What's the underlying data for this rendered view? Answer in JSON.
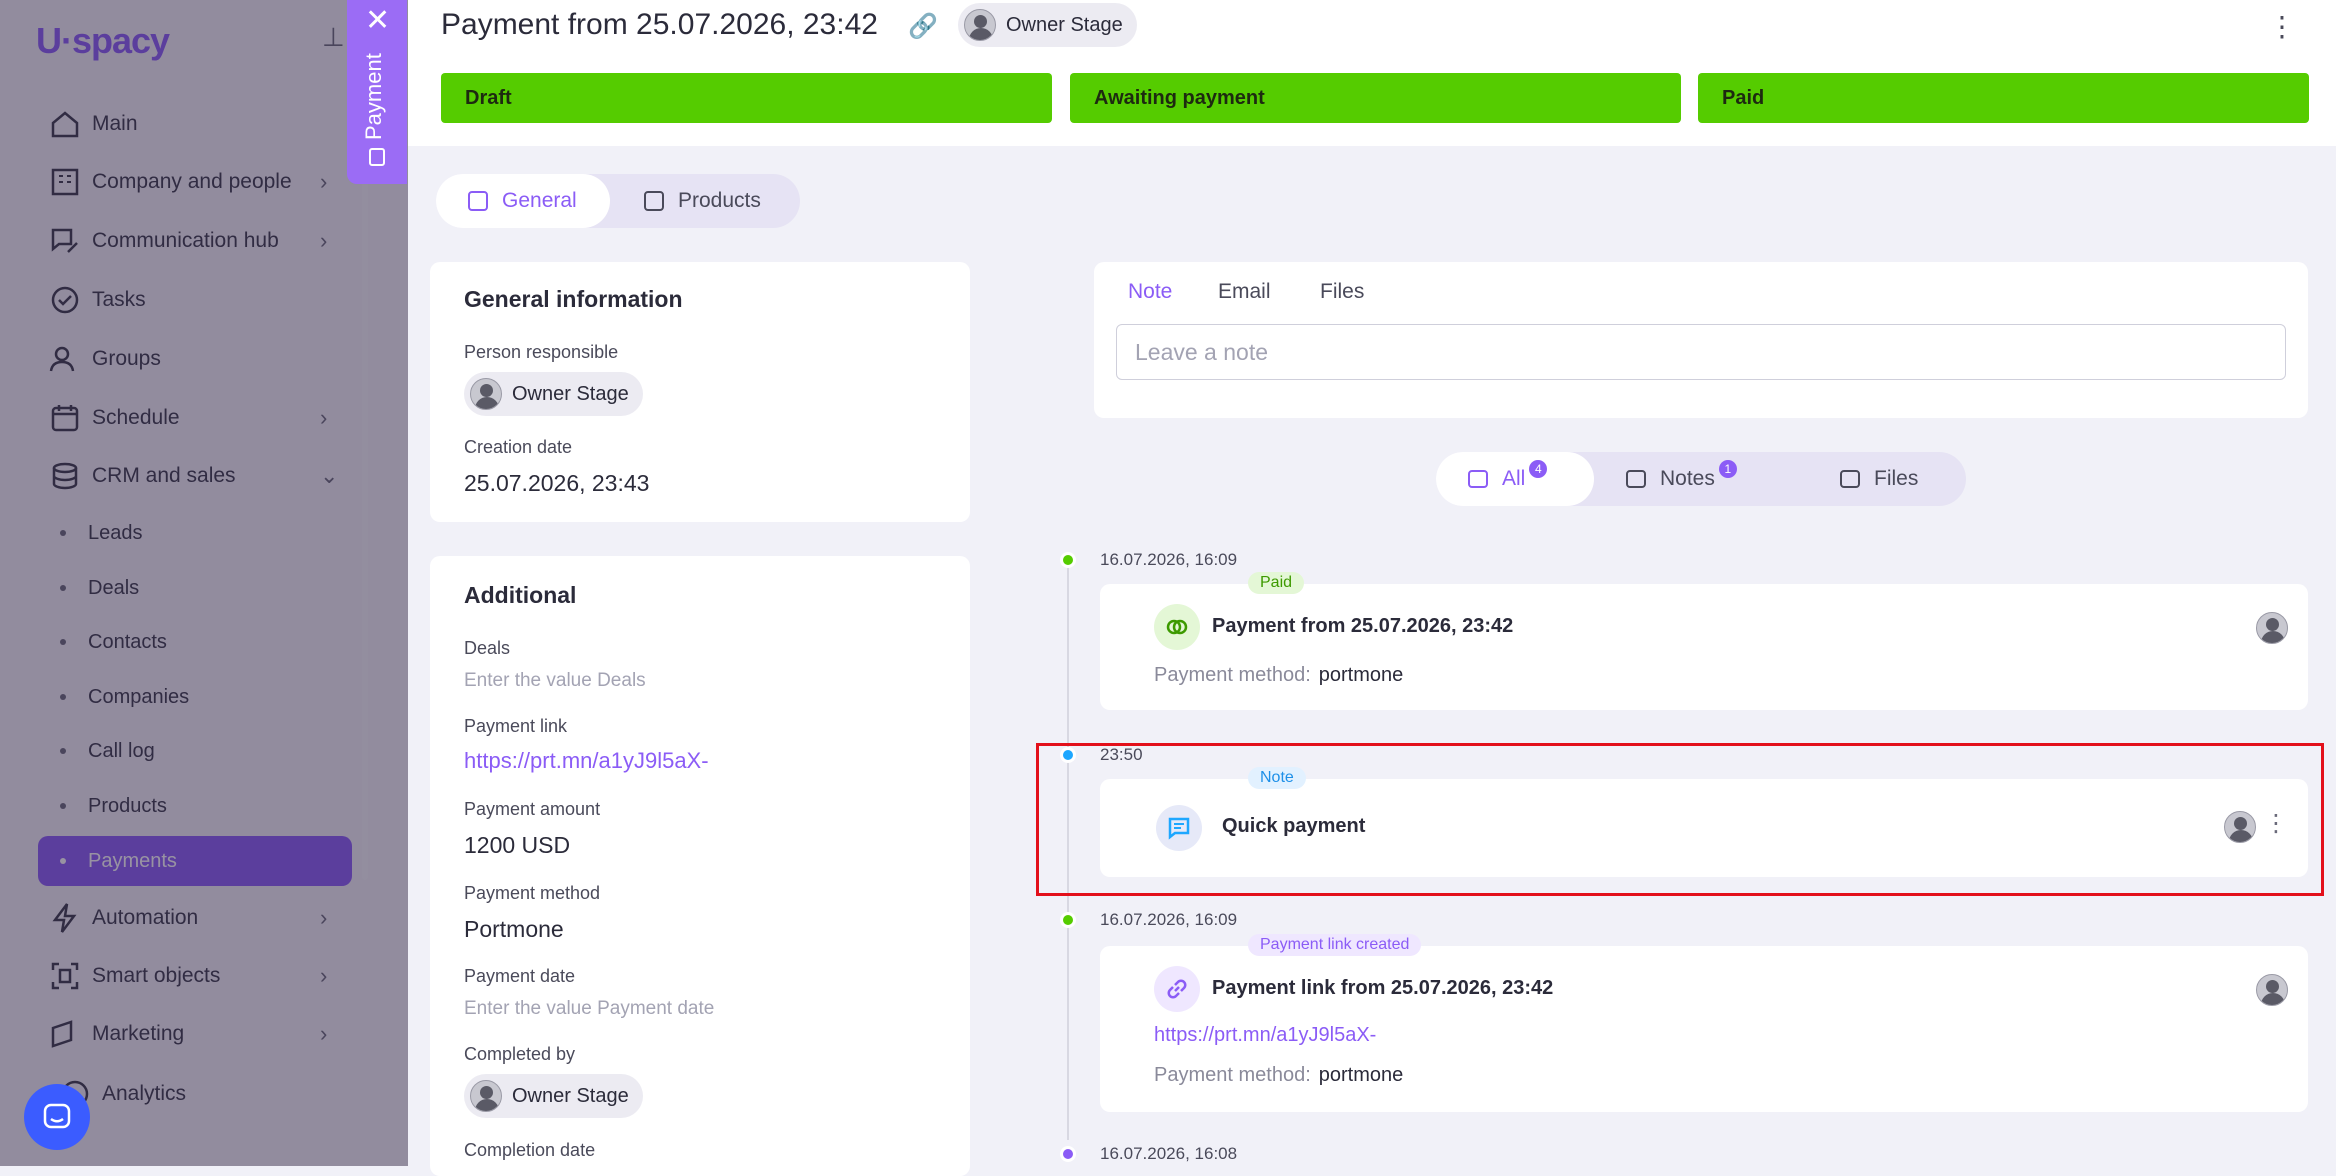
{
  "sidebar": {
    "logo": "U·spacy",
    "items": [
      {
        "label": "Main",
        "icon": "home-icon"
      },
      {
        "label": "Company and people",
        "icon": "building-icon"
      },
      {
        "label": "Communication hub",
        "icon": "chat-edit-icon"
      },
      {
        "label": "Tasks",
        "icon": "check-circle-icon"
      },
      {
        "label": "Groups",
        "icon": "users-icon"
      },
      {
        "label": "Schedule",
        "icon": "calendar-icon"
      },
      {
        "label": "CRM and sales",
        "icon": "database-icon"
      },
      {
        "label": "Automation",
        "icon": "bolt-icon"
      },
      {
        "label": "Smart objects",
        "icon": "smart-object-icon"
      },
      {
        "label": "Marketing",
        "icon": "marketing-icon"
      },
      {
        "label": "Analytics",
        "icon": "analytics-icon"
      }
    ],
    "crm_sub": [
      "Leads",
      "Deals",
      "Contacts",
      "Companies",
      "Call log",
      "Products",
      "Payments"
    ]
  },
  "panel_tab": {
    "label": "Payment"
  },
  "header": {
    "title": "Payment from 25.07.2026, 23:42",
    "owner": "Owner Stage",
    "stages": [
      "Draft",
      "Awaiting payment",
      "Paid"
    ],
    "stage_color": "#55cc00"
  },
  "tabs": {
    "general": "General",
    "products": "Products"
  },
  "general_info": {
    "title": "General information",
    "person_label": "Person responsible",
    "person": "Owner Stage",
    "creation_label": "Creation date",
    "creation_value": "25.07.2026, 23:43"
  },
  "additional": {
    "title": "Additional",
    "deals_label": "Deals",
    "deals_placeholder": "Enter the value Deals",
    "link_label": "Payment link",
    "link_value": "https://prt.mn/a1yJ9l5aX-",
    "amount_label": "Payment amount",
    "amount_value": "1200 USD",
    "method_label": "Payment method",
    "method_value": "Portmone",
    "date_label": "Payment date",
    "date_placeholder": "Enter the value Payment date",
    "completed_label": "Completed by",
    "completed_value": "Owner Stage",
    "completion_label": "Completion date"
  },
  "composer": {
    "tabs": [
      "Note",
      "Email",
      "Files"
    ],
    "placeholder": "Leave a note"
  },
  "filters": {
    "all": "All",
    "all_count": "4",
    "notes": "Notes",
    "notes_count": "1",
    "files": "Files"
  },
  "timeline": [
    {
      "time": "16.07.2026, 16:09",
      "badge": "Paid",
      "title": "Payment from 25.07.2026, 23:42",
      "meta_label": "Payment method:",
      "meta_value": "portmone"
    },
    {
      "time": "23:50",
      "badge": "Note",
      "title": "Quick payment"
    },
    {
      "time": "16.07.2026, 16:09",
      "badge": "Payment link created",
      "title": "Payment link from 25.07.2026, 23:42",
      "link": "https://prt.mn/a1yJ9l5aX-",
      "meta_label": "Payment method:",
      "meta_value": "portmone"
    },
    {
      "time": "16.07.2026, 16:08"
    }
  ],
  "colors": {
    "accent": "#8b5cf6",
    "highlight": "#e3101b"
  }
}
